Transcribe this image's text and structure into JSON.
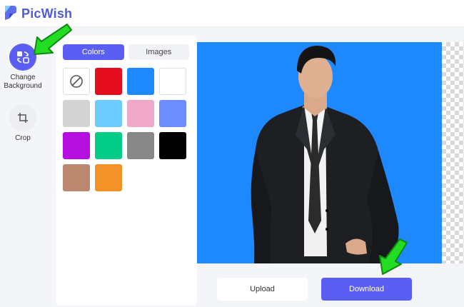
{
  "app": {
    "name": "PicWish",
    "brand_color": "#4f5bd5",
    "accent_color": "#5b5ef2"
  },
  "sidebar": {
    "tools": [
      {
        "label": "Change Background",
        "icon": "change-background-icon",
        "active": true
      },
      {
        "label": "Crop",
        "icon": "crop-icon",
        "active": false
      }
    ]
  },
  "panel": {
    "tabs": [
      {
        "label": "Colors",
        "active": true
      },
      {
        "label": "Images",
        "active": false
      }
    ],
    "swatches": [
      {
        "name": "none",
        "color": "none"
      },
      {
        "name": "red",
        "color": "#e60d1e"
      },
      {
        "name": "blue",
        "color": "#1e88ff"
      },
      {
        "name": "white",
        "color": "#ffffff"
      },
      {
        "name": "light-gray",
        "color": "#d3d3d3"
      },
      {
        "name": "sky-blue",
        "color": "#6cccff"
      },
      {
        "name": "pink",
        "color": "#f0a8c8"
      },
      {
        "name": "periwinkle",
        "color": "#6c8cff"
      },
      {
        "name": "purple",
        "color": "#b50fe0"
      },
      {
        "name": "green",
        "color": "#00cc88"
      },
      {
        "name": "gray",
        "color": "#888888"
      },
      {
        "name": "black",
        "color": "#000000"
      },
      {
        "name": "brown",
        "color": "#bb8870"
      },
      {
        "name": "orange",
        "color": "#f29228"
      }
    ]
  },
  "canvas": {
    "background_color": "#1e88ff"
  },
  "actions": {
    "upload_label": "Upload",
    "download_label": "Download"
  },
  "annotations": {
    "arrow_color": "#22dd22"
  }
}
